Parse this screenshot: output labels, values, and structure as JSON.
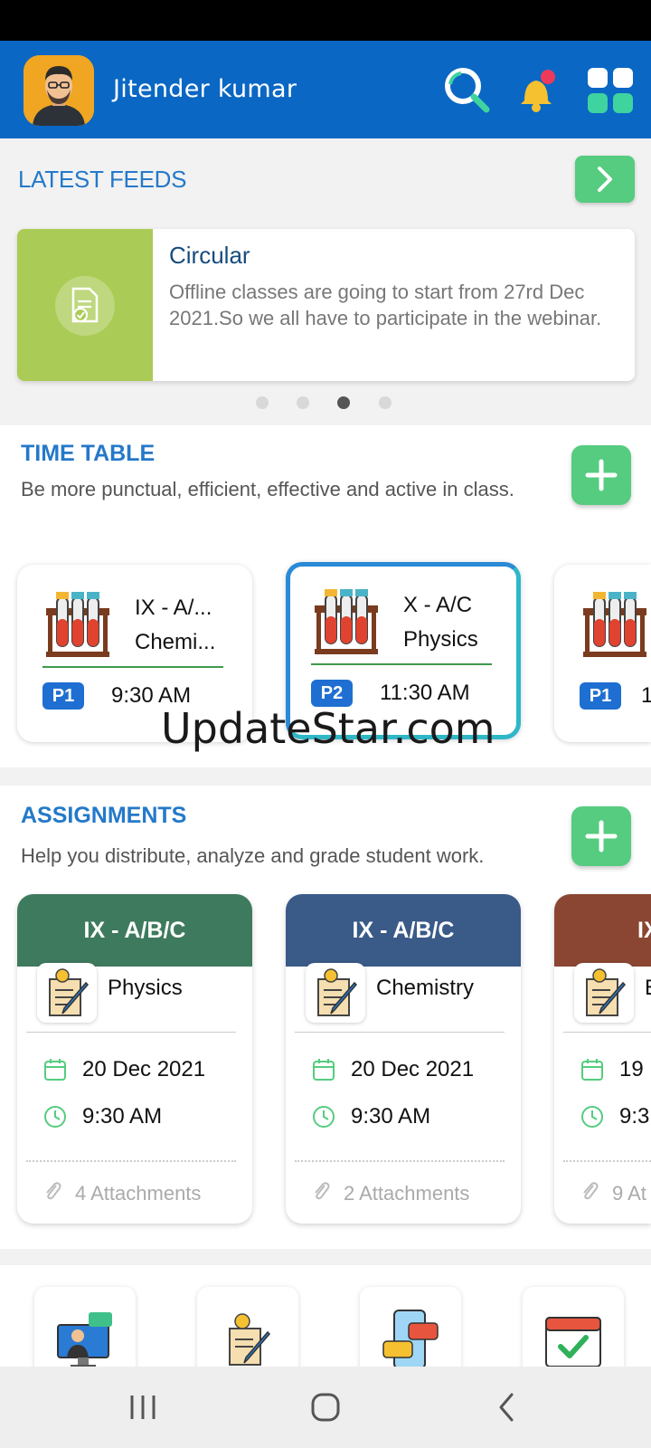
{
  "header": {
    "user_name": "Jitender kumar",
    "icons": [
      "avatar",
      "search-icon",
      "bell-icon",
      "apps-grid-icon"
    ]
  },
  "feeds": {
    "title": "LATEST FEEDS",
    "card": {
      "title": "Circular",
      "text": "Offline classes are going to start from 27rd Dec 2021.So we all have to participate in the webinar."
    },
    "pager": {
      "count": 4,
      "active_index": 2
    }
  },
  "timetable": {
    "title": "TIME TABLE",
    "subtitle": "Be more punctual, efficient, effective and active in class.",
    "cards": [
      {
        "class": "IX - A/...",
        "subject": "Chemi...",
        "period": "P1",
        "time": "9:30 AM",
        "selected": false
      },
      {
        "class": "X - A/C",
        "subject": "Physics",
        "period": "P2",
        "time": "11:30 AM",
        "selected": true
      },
      {
        "class": "",
        "subject": "",
        "period": "P1",
        "time": "1",
        "selected": false
      }
    ]
  },
  "assignments": {
    "title": "ASSIGNMENTS",
    "subtitle": "Help you distribute, analyze and grade student work.",
    "cards": [
      {
        "class": "IX - A/B/C",
        "subject": "Physics",
        "date": "20 Dec 2021",
        "time": "9:30 AM",
        "attachments": "4 Attachments",
        "color": "#3e7a5e"
      },
      {
        "class": "IX - A/B/C",
        "subject": "Chemistry",
        "date": "20 Dec 2021",
        "time": "9:30 AM",
        "attachments": "2 Attachments",
        "color": "#3a5a88"
      },
      {
        "class": "IX",
        "subject": "E",
        "date": "19 D",
        "time": "9:3",
        "attachments": "9 At",
        "color": "#8a4632"
      }
    ]
  },
  "quick_links": [
    "online-class-icon",
    "assignment-icon",
    "chat-icon",
    "attendance-calendar-icon"
  ],
  "watermark": "UpdateStar.com",
  "colors": {
    "header_bg": "#0a67c4",
    "accent_blue": "#2479c9",
    "green_button": "#55cc7f",
    "period_badge": "#1e6fd1"
  }
}
